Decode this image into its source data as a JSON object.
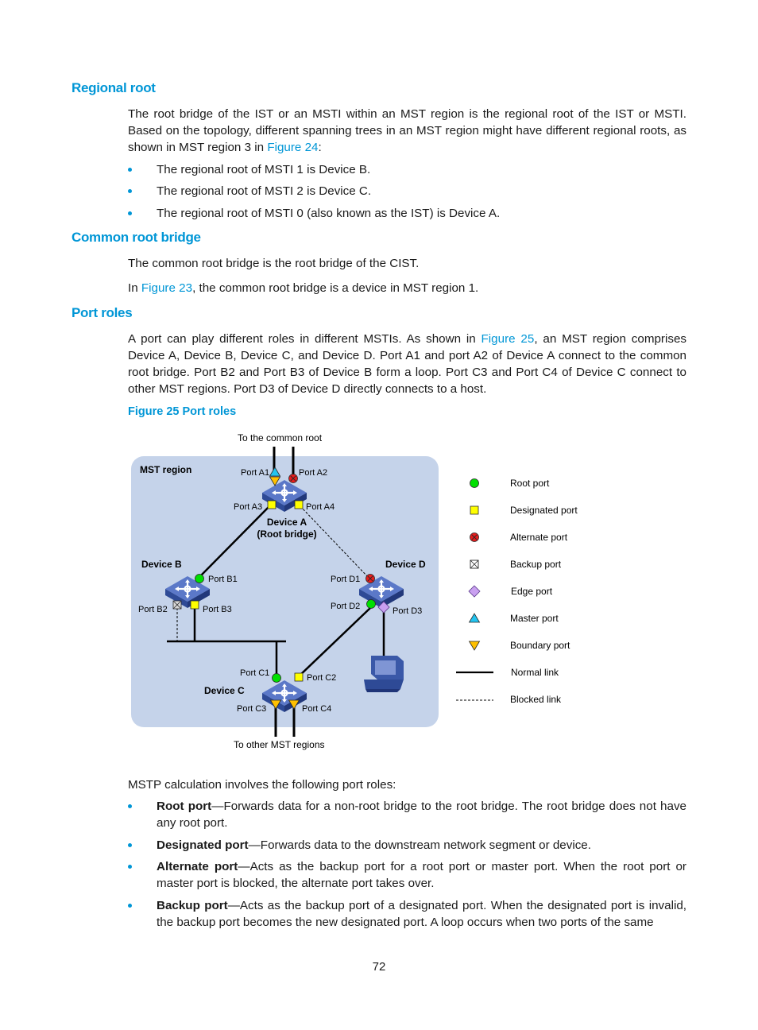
{
  "sections": {
    "regional_root": {
      "heading": "Regional root",
      "para_pre": "The root bridge of the IST or an MSTI within an MST region is the regional root of the IST or MSTI. Based on the topology, different spanning trees in an MST region might have different regional roots, as shown in MST region 3 in ",
      "para_link": "Figure 24",
      "para_post": ":",
      "bullets": [
        "The regional root of MSTI 1 is Device B.",
        "The regional root of MSTI 2 is Device C.",
        "The regional root of MSTI 0 (also known as the IST) is Device A."
      ]
    },
    "common_root_bridge": {
      "heading": "Common root bridge",
      "para1": "The common root bridge is the root bridge of the CIST.",
      "para2_pre": "In ",
      "para2_link": "Figure 23",
      "para2_post": ", the common root bridge is a device in MST region 1."
    },
    "port_roles": {
      "heading": "Port roles",
      "para_pre": "A port can play different roles in different MSTIs. As shown in ",
      "para_link": "Figure 25",
      "para_post": ", an MST region comprises Device A, Device B, Device C, and Device D. Port A1 and port A2 of Device A connect to the common root bridge. Port B2 and Port B3 of Device B form a loop. Port C3 and Port C4 of Device C connect to other MST regions. Port D3 of Device D directly connects to a host.",
      "figure_caption": "Figure 25 Port roles",
      "intro": "MSTP calculation involves the following port roles:",
      "roles": [
        {
          "term": "Root port",
          "desc": "—Forwards data for a non-root bridge to the root bridge. The root bridge does not have any root port."
        },
        {
          "term": "Designated port",
          "desc": "—Forwards data to the downstream network segment or device."
        },
        {
          "term": "Alternate port",
          "desc": "—Acts as the backup port for a root port or master port. When the root port or master port is blocked, the alternate port takes over."
        },
        {
          "term": "Backup port",
          "desc": "—Acts as the backup port of a designated port. When the designated port is invalid, the backup port becomes the new designated port. A loop occurs when two ports of the same"
        }
      ]
    }
  },
  "figure": {
    "top_label": "To the common root",
    "bottom_label": "To other MST regions",
    "region_label": "MST region",
    "devices": {
      "a": {
        "name": "Device A",
        "sub": "(Root bridge)"
      },
      "b": {
        "name": "Device B"
      },
      "c": {
        "name": "Device C"
      },
      "d": {
        "name": "Device D"
      }
    },
    "ports": {
      "a1": "Port A1",
      "a2": "Port A2",
      "a3": "Port A3",
      "a4": "Port A4",
      "b1": "Port B1",
      "b2": "Port B2",
      "b3": "Port B3",
      "c1": "Port C1",
      "c2": "Port C2",
      "c3": "Port C3",
      "c4": "Port C4",
      "d1": "Port D1",
      "d2": "Port D2",
      "d3": "Port D3"
    },
    "legend": [
      {
        "label": "Root port",
        "symbol": "green-circle"
      },
      {
        "label": "Designated port",
        "symbol": "yellow-square"
      },
      {
        "label": "Alternate port",
        "symbol": "red-crossed-circle"
      },
      {
        "label": "Backup port",
        "symbol": "crossed-square"
      },
      {
        "label": "Edge port",
        "symbol": "purple-diamond"
      },
      {
        "label": "Master port",
        "symbol": "cyan-triangle-up"
      },
      {
        "label": "Boundary port",
        "symbol": "orange-triangle-down"
      },
      {
        "label": "Normal link",
        "symbol": "solid-line"
      },
      {
        "label": "Blocked link",
        "symbol": "dashed-line"
      }
    ],
    "colors": {
      "region_bg": "#c5d3ea",
      "root_port": "#00e000",
      "designated_port": "#ffff00",
      "alternate_port": "#e81c1c",
      "edge_port": "#c9a0f0",
      "master_port": "#22c4f0",
      "boundary_port": "#ffc000",
      "switch": "#3a58a8"
    }
  },
  "page_number": "72"
}
